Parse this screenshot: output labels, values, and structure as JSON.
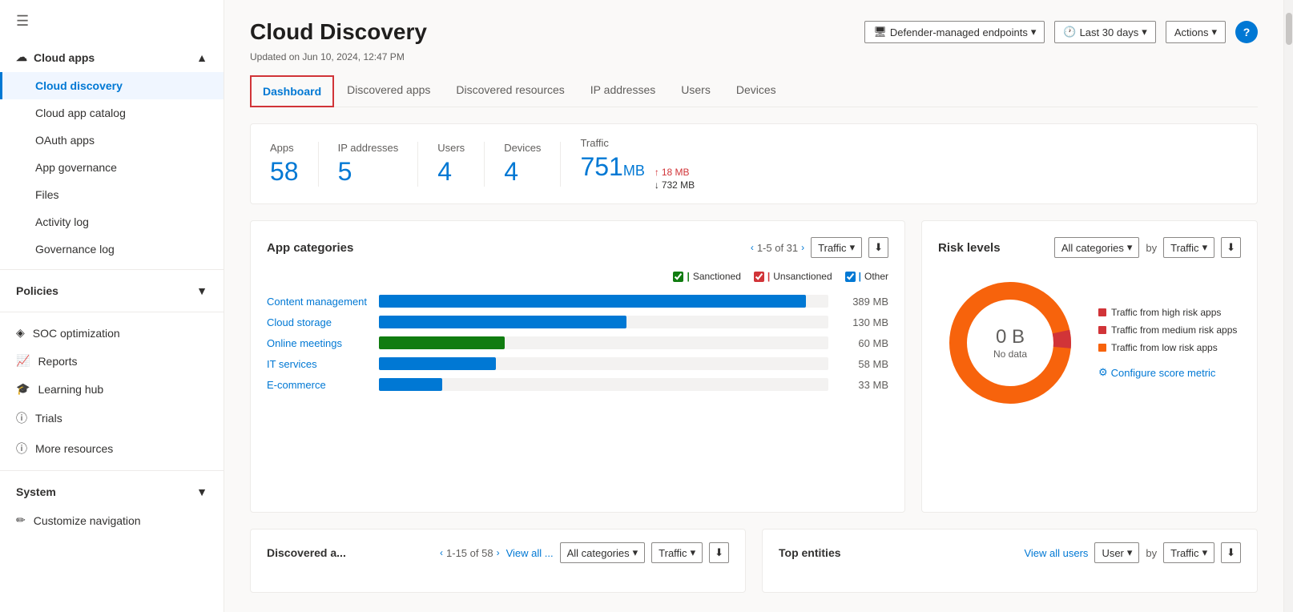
{
  "sidebar": {
    "hamburger_icon": "☰",
    "cloud_apps_label": "Cloud apps",
    "cloud_apps_chevron": "▲",
    "items": [
      {
        "id": "cloud-discovery",
        "label": "Cloud discovery",
        "active": true
      },
      {
        "id": "cloud-app-catalog",
        "label": "Cloud app catalog",
        "active": false
      },
      {
        "id": "oauth-apps",
        "label": "OAuth apps",
        "active": false
      },
      {
        "id": "app-governance",
        "label": "App governance",
        "active": false
      },
      {
        "id": "files",
        "label": "Files",
        "active": false
      },
      {
        "id": "activity-log",
        "label": "Activity log",
        "active": false
      },
      {
        "id": "governance-log",
        "label": "Governance log",
        "active": false
      }
    ],
    "policies_label": "Policies",
    "policies_chevron": "▼",
    "standalone_items": [
      {
        "id": "soc-optimization",
        "label": "SOC optimization",
        "icon": "◈"
      },
      {
        "id": "reports",
        "label": "Reports",
        "icon": "📈"
      },
      {
        "id": "learning-hub",
        "label": "Learning hub",
        "icon": "🎓"
      },
      {
        "id": "trials",
        "label": "Trials",
        "icon": "ⓘ"
      },
      {
        "id": "more-resources",
        "label": "More resources",
        "icon": "ⓘ"
      }
    ],
    "system_label": "System",
    "system_chevron": "▼",
    "customize_label": "Customize navigation"
  },
  "header": {
    "title": "Cloud Discovery",
    "updated_text": "Updated on Jun 10, 2024, 12:47 PM",
    "endpoint_btn": "Defender-managed endpoints",
    "time_btn": "Last 30 days",
    "actions_btn": "Actions",
    "help_btn": "?"
  },
  "tabs": [
    {
      "id": "dashboard",
      "label": "Dashboard",
      "active": true
    },
    {
      "id": "discovered-apps",
      "label": "Discovered apps",
      "active": false
    },
    {
      "id": "discovered-resources",
      "label": "Discovered resources",
      "active": false
    },
    {
      "id": "ip-addresses",
      "label": "IP addresses",
      "active": false
    },
    {
      "id": "users",
      "label": "Users",
      "active": false
    },
    {
      "id": "devices",
      "label": "Devices",
      "active": false
    }
  ],
  "stats": {
    "apps": {
      "label": "Apps",
      "value": "58"
    },
    "ip_addresses": {
      "label": "IP addresses",
      "value": "5"
    },
    "users": {
      "label": "Users",
      "value": "4"
    },
    "devices": {
      "label": "Devices",
      "value": "4"
    },
    "traffic": {
      "label": "Traffic",
      "value": "751",
      "unit": "MB",
      "upload": "18 MB",
      "download": "732 MB"
    }
  },
  "app_categories": {
    "title": "App categories",
    "pagination": "1-5 of 31",
    "dropdown": "Traffic",
    "legend": [
      {
        "label": "Sanctioned",
        "color": "#107c10"
      },
      {
        "label": "Unsanctioned",
        "color": "#d13438"
      },
      {
        "label": "Other",
        "color": "#0078d4"
      }
    ],
    "bars": [
      {
        "label": "Content management",
        "value": "389 MB",
        "pct": 95,
        "color": "#0078d4"
      },
      {
        "label": "Cloud storage",
        "value": "130 MB",
        "pct": 55,
        "color": "#0078d4"
      },
      {
        "label": "Online meetings",
        "value": "60 MB",
        "pct": 28,
        "color": "#107c10"
      },
      {
        "label": "IT services",
        "value": "58 MB",
        "pct": 26,
        "color": "#0078d4"
      },
      {
        "label": "E-commerce",
        "value": "33 MB",
        "pct": 14,
        "color": "#0078d4"
      }
    ]
  },
  "risk_levels": {
    "title": "Risk levels",
    "categories_label": "All categories",
    "by_label": "by",
    "traffic_label": "Traffic",
    "center_value": "0 B",
    "center_label": "No data",
    "legend": [
      {
        "label": "Traffic from high risk apps",
        "color": "#d13438"
      },
      {
        "label": "Traffic from medium risk apps",
        "color": "#d13438"
      },
      {
        "label": "Traffic from low risk apps",
        "color": "#f7630c"
      }
    ],
    "configure_link": "Configure score metric"
  },
  "discovered_apps": {
    "title": "Discovered a...",
    "pagination": "1-15 of 58",
    "view_all": "View all ...",
    "categories_label": "All categories",
    "traffic_label": "Traffic"
  },
  "top_entities": {
    "title": "Top entities",
    "view_all": "View all users",
    "user_label": "User",
    "by_label": "by",
    "traffic_label": "Traffic"
  }
}
